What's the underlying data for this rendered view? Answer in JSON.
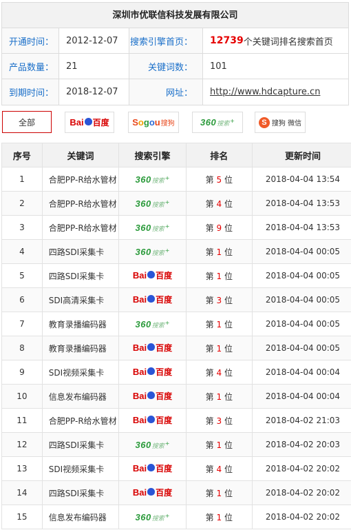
{
  "company": "深圳市优联信科技发展有限公司",
  "info": {
    "open_label": "开通时间：",
    "open_value": "2012-12-07",
    "engine_home_label": "搜索引擎首页：",
    "engine_home_count": "12739",
    "engine_home_suffix": "个关键词排名搜索首页",
    "product_label": "产品数量：",
    "product_value": "21",
    "keyword_label": "关键词数：",
    "keyword_value": "101",
    "expire_label": "到期时间：",
    "expire_value": "2018-12-07",
    "site_label": "网址：",
    "site_value": "http://www.hdcapture.cn"
  },
  "filters": {
    "all_label": "全部",
    "baidu": {
      "bai": "Bai",
      "du": "百度"
    },
    "sogou": {
      "S": "S",
      "o1": "o",
      "g": "g",
      "o2": "o",
      "u": "u",
      "cn": "搜狗"
    },
    "so360": {
      "n": "360",
      "t": "搜索",
      "s": "+"
    },
    "sogou_wx": {
      "icon": "S",
      "label": "搜狗 微信"
    }
  },
  "table": {
    "headers": [
      "序号",
      "关键词",
      "搜索引擎",
      "排名",
      "更新时间"
    ],
    "rank_prefix": "第",
    "rank_suffix": "位",
    "rows": [
      {
        "no": "1",
        "keyword": "合肥PP-R给水管材",
        "engine": "360",
        "rank": "5",
        "time": "2018-04-04 13:54"
      },
      {
        "no": "2",
        "keyword": "合肥PP-R给水管材",
        "engine": "360",
        "rank": "4",
        "time": "2018-04-04 13:53"
      },
      {
        "no": "3",
        "keyword": "合肥PP-R给水管材",
        "engine": "360",
        "rank": "9",
        "time": "2018-04-04 13:53"
      },
      {
        "no": "4",
        "keyword": "四路SDI采集卡",
        "engine": "360",
        "rank": "1",
        "time": "2018-04-04 00:05"
      },
      {
        "no": "5",
        "keyword": "四路SDI采集卡",
        "engine": "baidu",
        "rank": "1",
        "time": "2018-04-04 00:05"
      },
      {
        "no": "6",
        "keyword": "SDI高清采集卡",
        "engine": "baidu",
        "rank": "3",
        "time": "2018-04-04 00:05"
      },
      {
        "no": "7",
        "keyword": "教育录播编码器",
        "engine": "360",
        "rank": "1",
        "time": "2018-04-04 00:05"
      },
      {
        "no": "8",
        "keyword": "教育录播编码器",
        "engine": "baidu",
        "rank": "1",
        "time": "2018-04-04 00:05"
      },
      {
        "no": "9",
        "keyword": "SDI视频采集卡",
        "engine": "baidu",
        "rank": "4",
        "time": "2018-04-04 00:04"
      },
      {
        "no": "10",
        "keyword": "信息发布编码器",
        "engine": "baidu",
        "rank": "1",
        "time": "2018-04-04 00:04"
      },
      {
        "no": "11",
        "keyword": "合肥PP-R给水管材",
        "engine": "baidu",
        "rank": "3",
        "time": "2018-04-02 21:03"
      },
      {
        "no": "12",
        "keyword": "四路SDI采集卡",
        "engine": "360",
        "rank": "1",
        "time": "2018-04-02 20:03"
      },
      {
        "no": "13",
        "keyword": "SDI视频采集卡",
        "engine": "baidu",
        "rank": "4",
        "time": "2018-04-02 20:02"
      },
      {
        "no": "14",
        "keyword": "四路SDI采集卡",
        "engine": "baidu",
        "rank": "1",
        "time": "2018-04-02 20:02"
      },
      {
        "no": "15",
        "keyword": "信息发布编码器",
        "engine": "360",
        "rank": "1",
        "time": "2018-04-02 20:02"
      }
    ]
  }
}
